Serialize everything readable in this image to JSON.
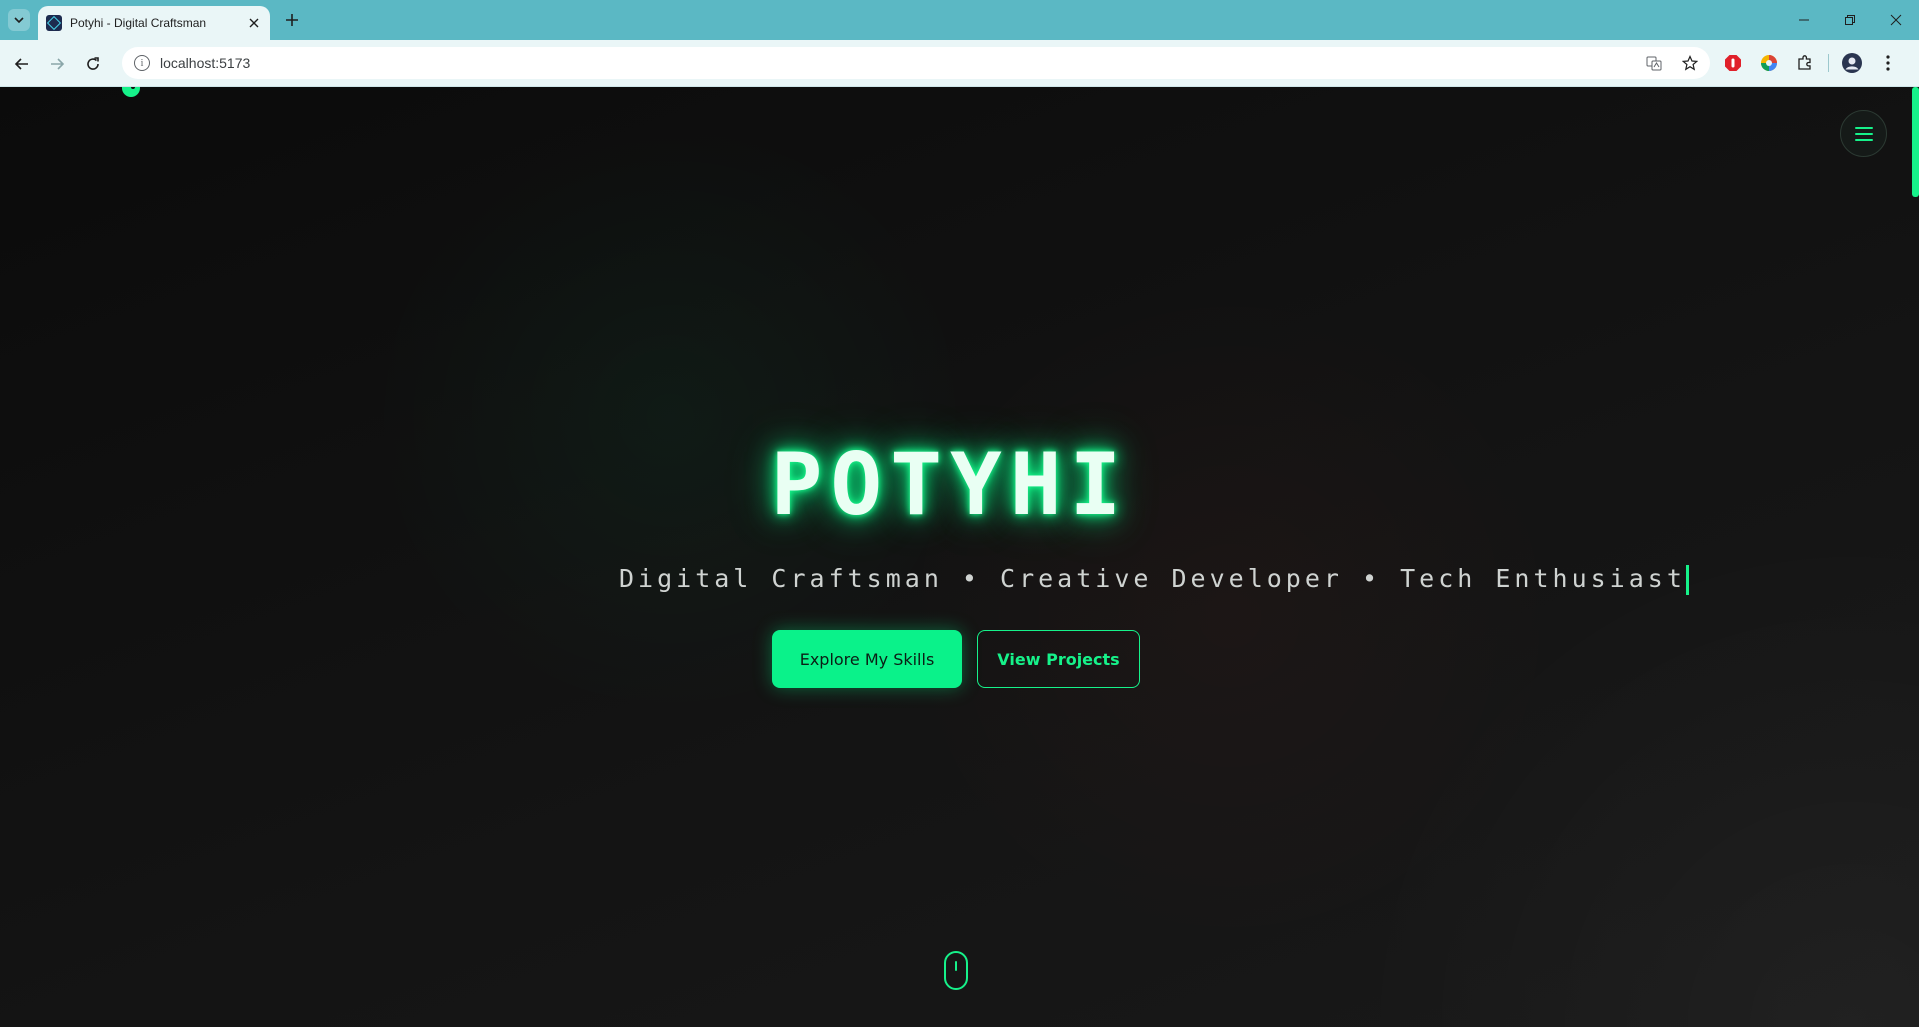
{
  "browser": {
    "tab_title": "Potyhi - Digital Craftsman",
    "url": "localhost:5173"
  },
  "hero": {
    "title": "POTYHI",
    "subtitle": "Digital Craftsman • Creative Developer • Tech Enthusiast",
    "primary_button": "Explore My Skills",
    "secondary_button": "View Projects"
  },
  "theme": {
    "accent": "#16f28a",
    "background": "#0f0f0f",
    "browser_frame": "#5bb8c4"
  },
  "icons": {
    "menu": "hamburger-icon",
    "scroll": "mouse-scroll-icon"
  }
}
